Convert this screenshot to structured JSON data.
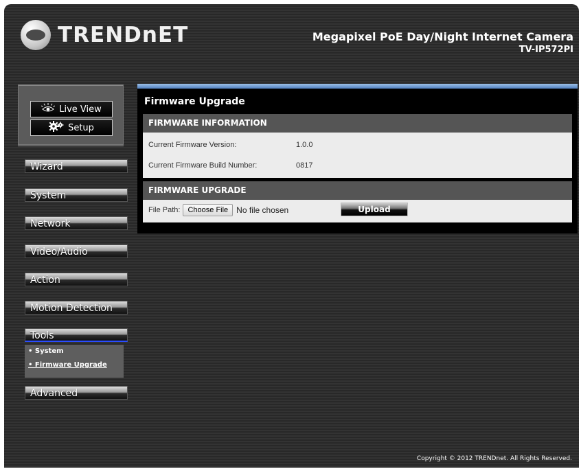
{
  "header": {
    "brand": "TRENDnET",
    "product_title": "Megapixel PoE Day/Night Internet Camera",
    "model": "TV-IP572PI"
  },
  "view_buttons": {
    "live_view": "Live View",
    "setup": "Setup"
  },
  "nav": {
    "wizard": "Wizard",
    "system": "System",
    "network": "Network",
    "video_audio": "Video/Audio",
    "action": "Action",
    "motion_detection": "Motion Detection",
    "tools": "Tools",
    "advanced": "Advanced",
    "tools_sub": [
      "• System",
      "• Firmware Upgrade"
    ]
  },
  "main": {
    "title": "Firmware Upgrade",
    "info_section": {
      "heading": "FIRMWARE INFORMATION",
      "version_label": "Current Firmware Version:",
      "version_value": "1.0.0",
      "build_label": "Current Firmware Build Number:",
      "build_value": "0817"
    },
    "upgrade_section": {
      "heading": "FIRMWARE UPGRADE",
      "file_path_label": "File Path:",
      "choose_file": "Choose File",
      "no_file": "No file chosen",
      "upload": "Upload"
    }
  },
  "footer": "Copyright © 2012 TRENDnet. All Rights Reserved.",
  "colors": {
    "accent_blue": "#2a4cff",
    "panel_bar": "#6f9bd6"
  }
}
